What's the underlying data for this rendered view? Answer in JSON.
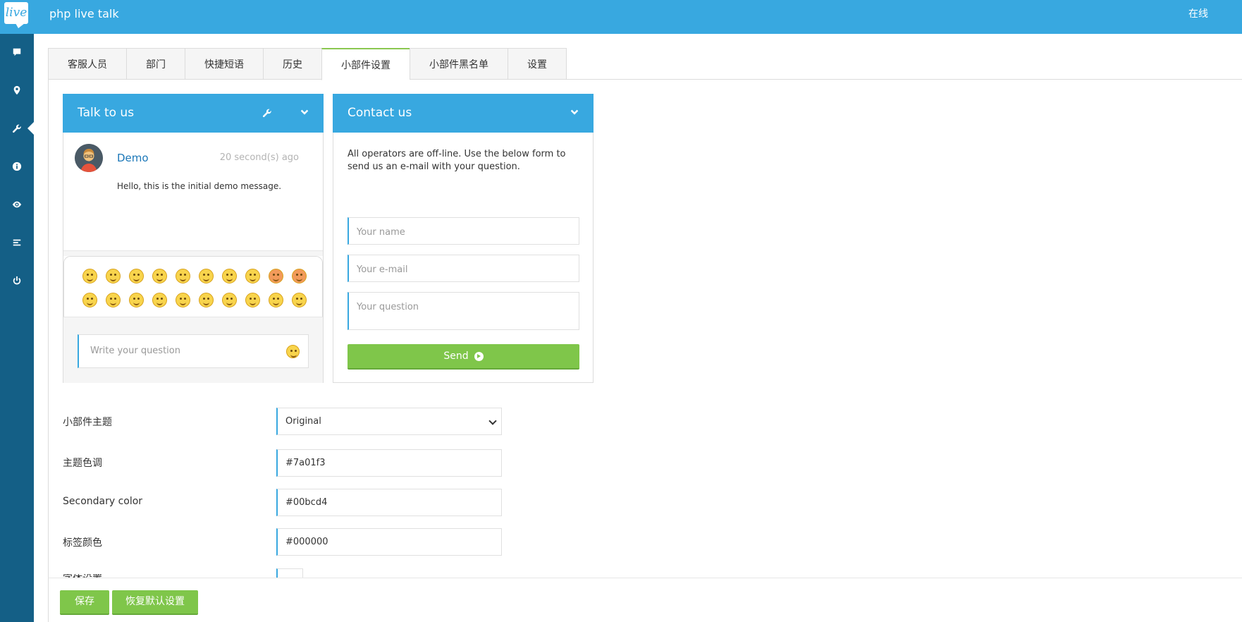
{
  "app": {
    "logo_text": "live",
    "title": "php live talk",
    "status": "在线"
  },
  "sidebar": {
    "items": [
      {
        "icon": "chat-icon"
      },
      {
        "icon": "map-marker-icon"
      },
      {
        "icon": "wrench-icon",
        "active": true
      },
      {
        "icon": "info-icon"
      },
      {
        "icon": "eye-icon"
      },
      {
        "icon": "list-icon"
      },
      {
        "icon": "power-icon"
      }
    ]
  },
  "tabs": [
    {
      "label": "客服人员"
    },
    {
      "label": "部门"
    },
    {
      "label": "快捷短语"
    },
    {
      "label": "历史"
    },
    {
      "label": "小部件设置",
      "active": true
    },
    {
      "label": "小部件黑名单"
    },
    {
      "label": "设置"
    }
  ],
  "chat_widget": {
    "title": "Talk to us",
    "message": {
      "author": "Demo",
      "time": "20 second(s) ago",
      "text": "Hello, this is the initial demo message."
    },
    "input_placeholder": "Write your question"
  },
  "contact_widget": {
    "title": "Contact us",
    "text": "All operators are off-line. Use the below form to send us an e-mail with your question.",
    "name_placeholder": "Your name",
    "email_placeholder": "Your e-mail",
    "question_placeholder": "Your question",
    "send_label": "Send"
  },
  "form": {
    "theme_label": "小部件主题",
    "theme_value": "Original",
    "primary_label": "主题色调",
    "primary_value": "#7a01f3",
    "secondary_label": "Secondary color",
    "secondary_value": "#00bcd4",
    "label_color_label": "标签颜色",
    "label_color_value": "#000000",
    "partial_label": "字体设置"
  },
  "footer": {
    "save_label": "保存",
    "reset_label": "恢复默认设置"
  },
  "colors": {
    "accent": "#38a8e0",
    "sidebar": "#145f86",
    "button": "#7fc64a",
    "link": "#1b77b8"
  }
}
